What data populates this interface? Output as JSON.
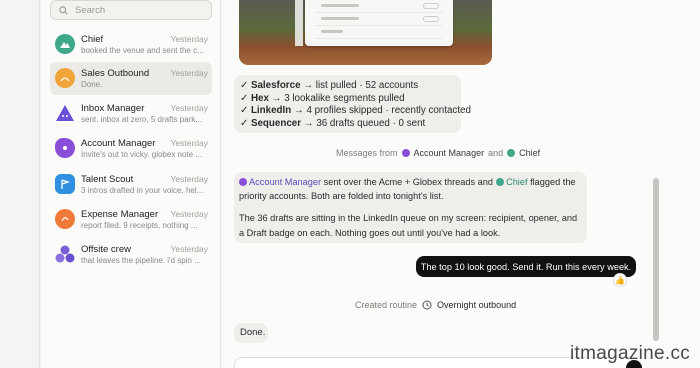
{
  "search": {
    "placeholder": "Search",
    "icon": "search-icon"
  },
  "conversations": [
    {
      "name": "Chief",
      "time": "Yesterday",
      "preview": "booked the venue and sent the c...",
      "avatar_color": "#3fa88a",
      "active": false
    },
    {
      "name": "Sales Outbound",
      "time": "Yesterday",
      "preview": "Done.",
      "avatar_color": "#f0a43a",
      "active": true
    },
    {
      "name": "Inbox Manager",
      "time": "Yesterday",
      "preview": "sent. inbox at zero, 5 drafts park...",
      "avatar_color": "#6a4fd8",
      "active": false
    },
    {
      "name": "Account Manager",
      "time": "Yesterday",
      "preview": "Invite's out to vicky. globex note ...",
      "avatar_color": "#8a4fd8",
      "active": false
    },
    {
      "name": "Talent Scout",
      "time": "Yesterday",
      "preview": "3 intros drafted in your voice, hel...",
      "avatar_color": "#2f8fe0",
      "active": false
    },
    {
      "name": "Expense Manager",
      "time": "Yesterday",
      "preview": "report filed. 9 receipts, nothing ...",
      "avatar_color": "#f07a3a",
      "active": false
    },
    {
      "name": "Offsite crew",
      "time": "Yesterday",
      "preview": "that leaves the pipeline. i'd spin ...",
      "avatar_color": "#7a5fd8",
      "active": false
    }
  ],
  "summary_steps": [
    {
      "check": "✓",
      "tool": "Salesforce",
      "text": "→ list pulled · 52 accounts"
    },
    {
      "check": "✓",
      "tool": "Hex",
      "text": "→ 3 lookalike segments pulled"
    },
    {
      "check": "✓",
      "tool": "LinkedIn",
      "text": "→ 4 profiles skipped · recently contacted"
    },
    {
      "check": "✓",
      "tool": "Sequencer",
      "text": "→ 36 drafts queued · 0 sent"
    }
  ],
  "messages_from": {
    "prefix": "Messages from",
    "agent_a": "Account Manager",
    "agent_a_color": "#8a4fd8",
    "joiner": "and",
    "agent_b": "Chief",
    "agent_b_color": "#3fa88a"
  },
  "agent_message": {
    "mention_a": "Account Manager",
    "text_a": "sent over the Acme + Globex threads and",
    "mention_b": "Chief",
    "text_b": "flagged the priority accounts. Both are folded into tonight's list.",
    "paragraph_2": "The 36 drafts are sitting in the LinkedIn queue on my screen: recipient, opener, and a Draft badge on each. Nothing goes out until you've had a look."
  },
  "user_message": {
    "text": "The top 10 look good. Send it. Run this every week.",
    "reaction": "👍"
  },
  "routine": {
    "prefix": "Created routine",
    "icon": "clock-icon",
    "name": "Overnight outbound"
  },
  "final_reply": "Done.",
  "watermark": "itmagazine.cc"
}
